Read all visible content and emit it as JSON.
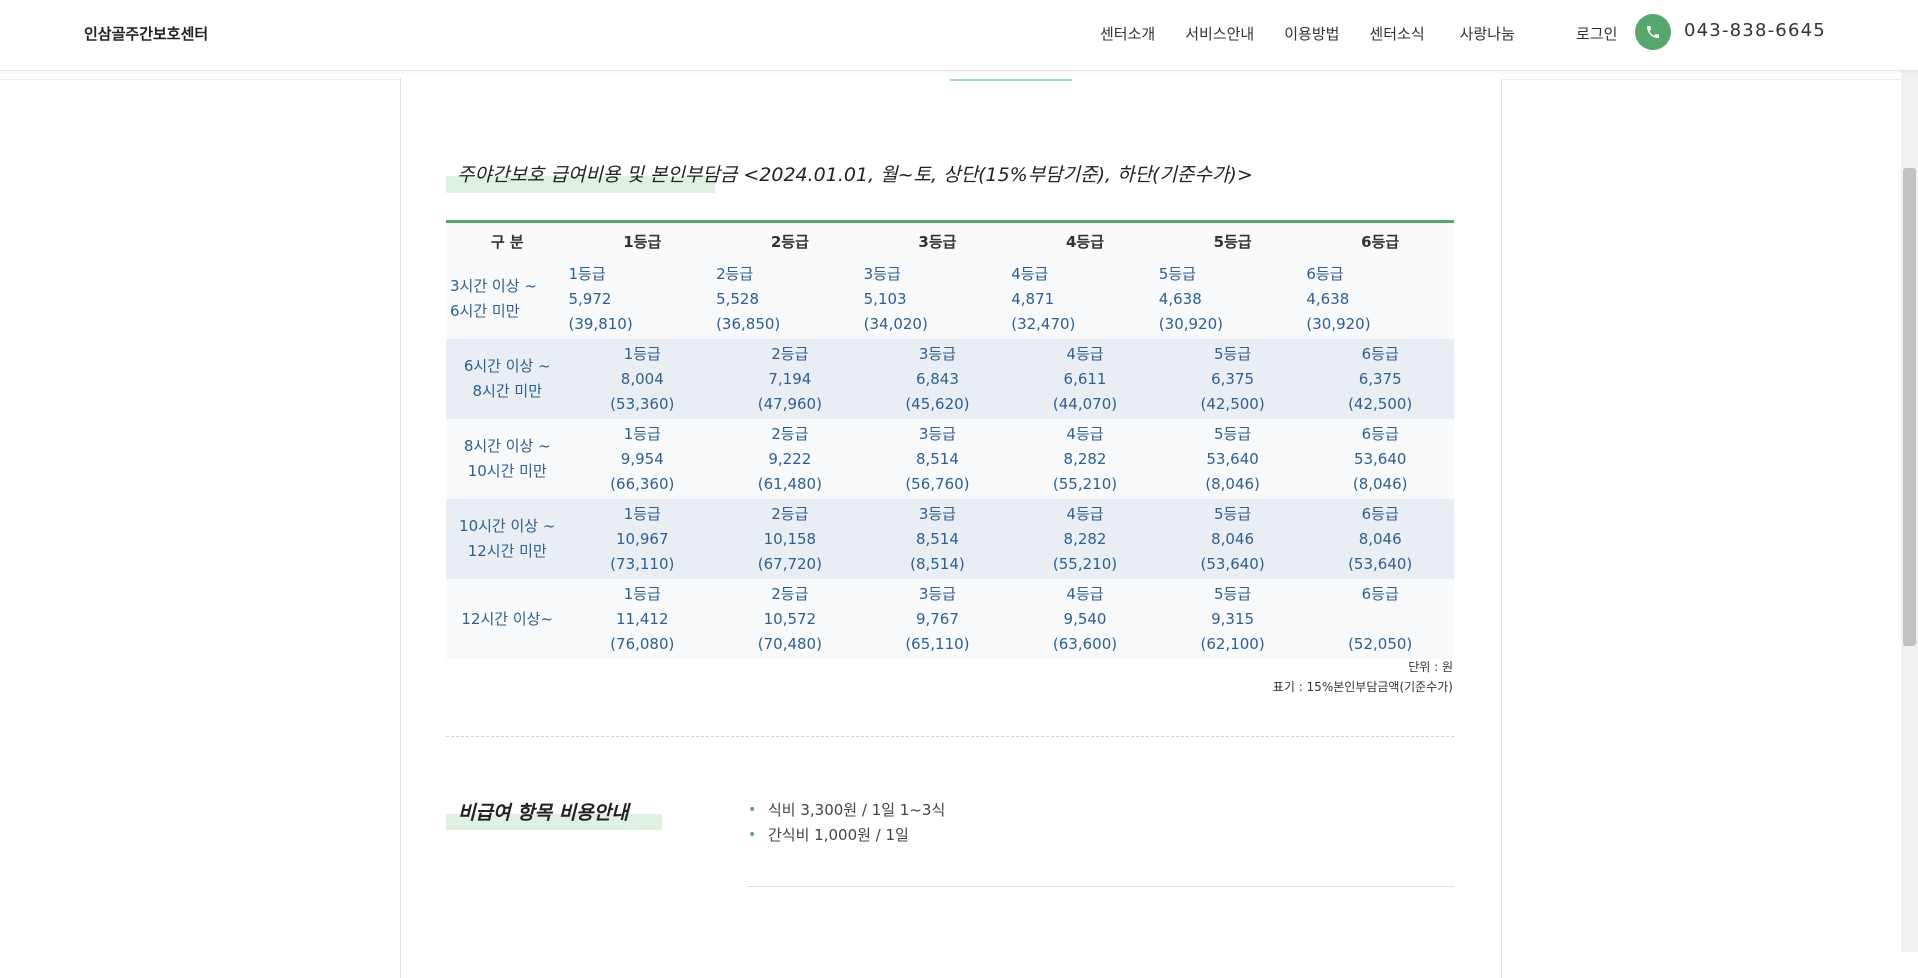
{
  "header": {
    "logo": "인삼골주간보호센터",
    "nav": [
      "센터소개",
      "서비스안내",
      "이용방법",
      "센터소식",
      "사랑나눔"
    ],
    "login": "로그인",
    "phone": "043-838-6645"
  },
  "fee_section": {
    "title": "주야간보호 급여비용 및 본인부담금 <2024.01.01, 월~토, 상단(15%부담기준), 하단(기준수가)>",
    "columns": [
      "구 분",
      "1등급",
      "2등급",
      "3등급",
      "4등급",
      "5등급",
      "6등급"
    ],
    "rows": [
      {
        "label": [
          "3시간 이상 ~",
          "6시간 미만"
        ],
        "cells": [
          [
            "1등급",
            "5,972",
            "(39,810)"
          ],
          [
            "2등급",
            "5,528",
            "(36,850)"
          ],
          [
            "3등급",
            "5,103",
            "(34,020)"
          ],
          [
            "4등급",
            "4,871",
            "(32,470)"
          ],
          [
            "5등급",
            "4,638",
            "(30,920)"
          ],
          [
            "6등급",
            "4,638",
            "(30,920)"
          ]
        ]
      },
      {
        "label": [
          "6시간 이상 ~",
          "8시간 미만"
        ],
        "cells": [
          [
            "1등급",
            "8,004",
            "(53,360)"
          ],
          [
            "2등급",
            "7,194",
            "(47,960)"
          ],
          [
            "3등급",
            "6,843",
            "(45,620)"
          ],
          [
            "4등급",
            "6,611",
            "(44,070)"
          ],
          [
            "5등급",
            "6,375",
            "(42,500)"
          ],
          [
            "6등급",
            "6,375",
            "(42,500)"
          ]
        ]
      },
      {
        "label": [
          "8시간 이상 ~",
          "10시간 미만"
        ],
        "cells": [
          [
            "1등급",
            "9,954",
            "(66,360)"
          ],
          [
            "2등급",
            "9,222",
            "(61,480)"
          ],
          [
            "3등급",
            "8,514",
            "(56,760)"
          ],
          [
            "4등급",
            "8,282",
            "(55,210)"
          ],
          [
            "5등급",
            "53,640",
            "(8,046)"
          ],
          [
            "6등급",
            "53,640",
            "(8,046)"
          ]
        ]
      },
      {
        "label": [
          "10시간 이상 ~",
          "12시간 미만"
        ],
        "cells": [
          [
            "1등급",
            "10,967",
            "(73,110)"
          ],
          [
            "2등급",
            "10,158",
            "(67,720)"
          ],
          [
            "3등급",
            "8,514",
            "(8,514)"
          ],
          [
            "4등급",
            "8,282",
            "(55,210)"
          ],
          [
            "5등급",
            "8,046",
            "(53,640)"
          ],
          [
            "6등급",
            "8,046",
            "(53,640)"
          ]
        ]
      },
      {
        "label": [
          "12시간 이상~"
        ],
        "cells": [
          [
            "1등급",
            "11,412",
            "(76,080)"
          ],
          [
            "2등급",
            "10,572",
            "(70,480)"
          ],
          [
            "3등급",
            "9,767",
            "(65,110)"
          ],
          [
            "4등급",
            "9,540",
            "(63,600)"
          ],
          [
            "5등급",
            "9,315",
            "(62,100)"
          ],
          [
            "6등급",
            "",
            "(52,050)"
          ]
        ]
      }
    ],
    "unit": "단위 : 원",
    "note": "표기 : 15%본인부담금액(기준수가)"
  },
  "nonbenefit_section": {
    "title": "비급여 항목 비용안내",
    "items": [
      "식비 3,300원 / 1일 1~3식",
      "간식비 1,000원 / 1일"
    ]
  },
  "colors": {
    "accent": "#56a66e",
    "table_text": "#2e5f8e",
    "row_alt": "#e9eef4",
    "title_highlight": "#dff1e2"
  }
}
